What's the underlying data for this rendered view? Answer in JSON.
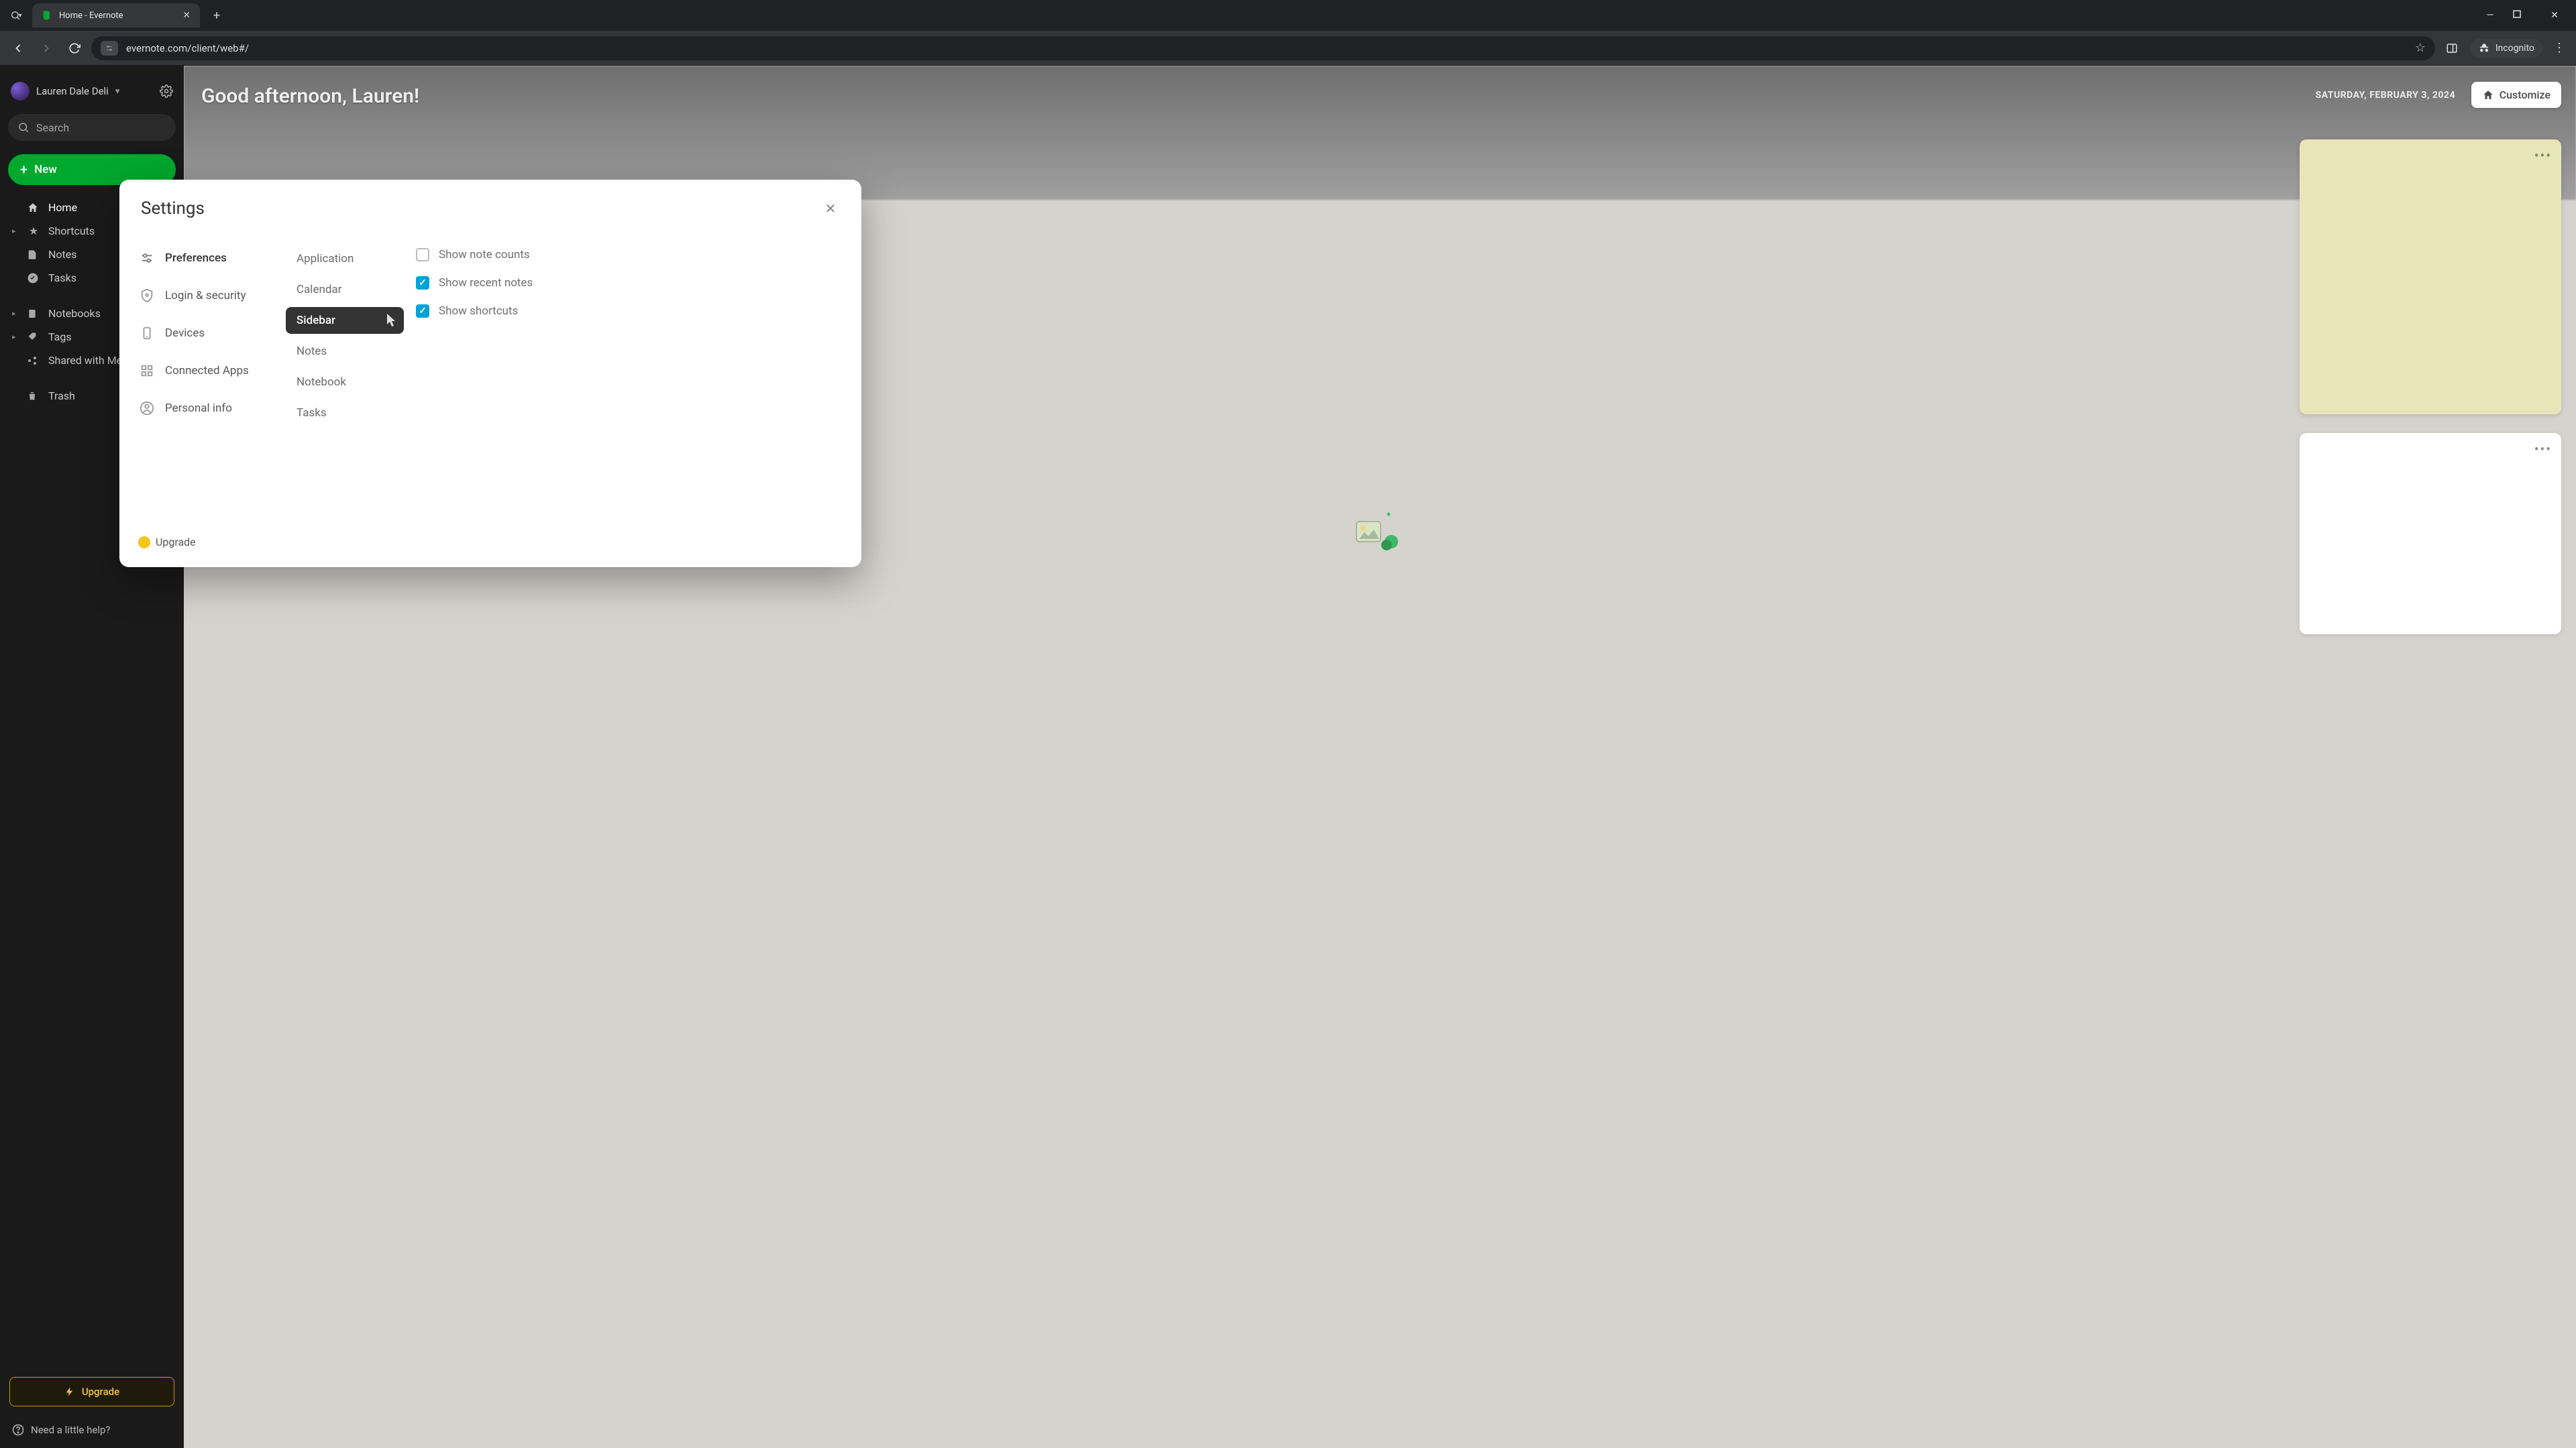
{
  "browser": {
    "tab_title": "Home - Evernote",
    "url": "evernote.com/client/web#/",
    "incognito_label": "Incognito"
  },
  "sidebar": {
    "username": "Lauren Dale Deli",
    "search_placeholder": "Search",
    "new_label": "New",
    "items": [
      {
        "icon": "home",
        "label": "Home",
        "caret": false
      },
      {
        "icon": "star",
        "label": "Shortcuts",
        "caret": true
      },
      {
        "icon": "note",
        "label": "Notes",
        "caret": false
      },
      {
        "icon": "check",
        "label": "Tasks",
        "caret": false
      },
      {
        "icon": "book",
        "label": "Notebooks",
        "caret": true
      },
      {
        "icon": "tag",
        "label": "Tags",
        "caret": true
      },
      {
        "icon": "share",
        "label": "Shared with Me",
        "caret": false
      },
      {
        "icon": "trash",
        "label": "Trash",
        "caret": false
      }
    ],
    "upgrade_label": "Upgrade",
    "help_label": "Need a little help?"
  },
  "main": {
    "greeting": "Good afternoon, Lauren!",
    "date": "SATURDAY, FEBRUARY 3, 2024",
    "customize_label": "Customize"
  },
  "settings": {
    "title": "Settings",
    "categories": [
      {
        "key": "preferences",
        "label": "Preferences"
      },
      {
        "key": "login",
        "label": "Login & security"
      },
      {
        "key": "devices",
        "label": "Devices"
      },
      {
        "key": "apps",
        "label": "Connected Apps"
      },
      {
        "key": "personal",
        "label": "Personal info"
      }
    ],
    "active_category": "preferences",
    "upgrade_label": "Upgrade",
    "subitems": [
      {
        "key": "application",
        "label": "Application"
      },
      {
        "key": "calendar",
        "label": "Calendar"
      },
      {
        "key": "sidebar",
        "label": "Sidebar"
      },
      {
        "key": "notes",
        "label": "Notes"
      },
      {
        "key": "notebook",
        "label": "Notebook"
      },
      {
        "key": "tasks",
        "label": "Tasks"
      }
    ],
    "active_subitem": "sidebar",
    "options": [
      {
        "key": "note_counts",
        "label": "Show note counts",
        "checked": false
      },
      {
        "key": "recent_notes",
        "label": "Show recent notes",
        "checked": true
      },
      {
        "key": "shortcuts",
        "label": "Show shortcuts",
        "checked": true
      }
    ]
  }
}
